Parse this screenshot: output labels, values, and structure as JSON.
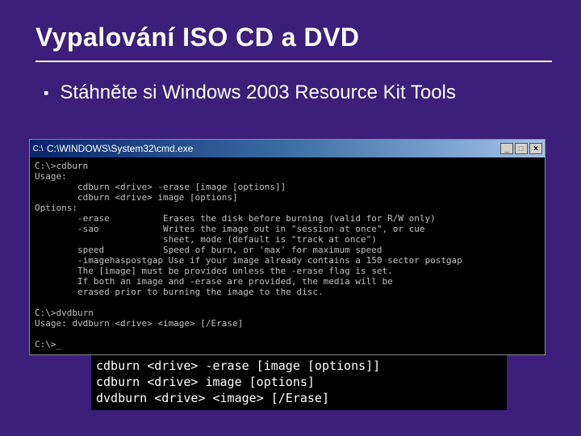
{
  "slide": {
    "title": "Vypalování ISO CD a DVD",
    "bullet": "Stáhněte si Windows 2003 Resource Kit Tools",
    "bullet_marker": "▪"
  },
  "window": {
    "icon_glyph": "C:\\",
    "title": "C:\\WINDOWS\\System32\\cmd.exe",
    "min_label": "_",
    "max_label": "□",
    "close_label": "×"
  },
  "console_text": "C:\\>cdburn\nUsage:\n        cdburn <drive> -erase [image [options]]\n        cdburn <drive> image [options]\nOptions:\n        -erase          Erases the disk before burning (valid for R/W only)\n        -sao            Writes the image out in \"session at once\", or cue\n                        sheet, mode (default is \"track at once\")\n        speed           Speed of burn, or 'max' for maximum speed\n        -imagehaspostgap Use if your image already contains a 150 sector postgap\n        The [image] must be provided unless the -erase flag is set.\n        If both an image and -erase are provided, the media will be\n        erased prior to burning the image to the disc.\n\nC:\\>dvdburn\nUsage: dvdburn <drive> <image> [/Erase]\n\nC:\\>_",
  "summary_text": "cdburn <drive> -erase [image [options]]\ncdburn <drive> image [options]\ndvdburn <drive> <image> [/Erase]"
}
